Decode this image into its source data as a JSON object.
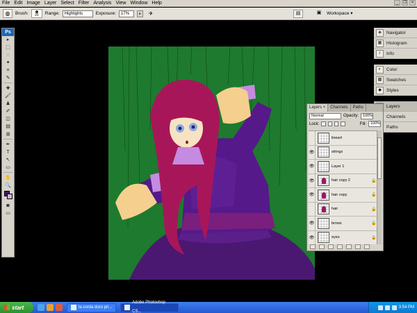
{
  "menu": {
    "items": [
      "File",
      "Edit",
      "Image",
      "Layer",
      "Select",
      "Filter",
      "Analysis",
      "View",
      "Window",
      "Help"
    ]
  },
  "options_bar": {
    "brush_label": "Brush:",
    "brush_size": "20",
    "range_label": "Range:",
    "range_value": "Highlights",
    "exposure_label": "Exposure:",
    "exposure_value": "17%",
    "workspace_label": "Workspace ▾"
  },
  "toolbox": {
    "logo": "Ps",
    "tools": [
      {
        "glyph": "▸",
        "name": "move-tool-icon"
      },
      {
        "glyph": "⬚",
        "name": "marquee-tool-icon"
      },
      {
        "glyph": "◌",
        "name": "lasso-tool-icon"
      },
      {
        "glyph": "✦",
        "name": "magic-wand-icon"
      },
      {
        "glyph": "⌗",
        "name": "crop-tool-icon"
      },
      {
        "glyph": "✎",
        "name": "slice-tool-icon"
      },
      {
        "glyph": "✚",
        "name": "healing-brush-icon"
      },
      {
        "glyph": "🖌",
        "name": "brush-tool-icon"
      },
      {
        "glyph": "♟",
        "name": "clone-stamp-icon"
      },
      {
        "glyph": "✐",
        "name": "history-brush-icon"
      },
      {
        "glyph": "◫",
        "name": "eraser-tool-icon"
      },
      {
        "glyph": "▤",
        "name": "gradient-tool-icon"
      },
      {
        "glyph": "◍",
        "name": "dodge-tool-icon"
      },
      {
        "glyph": "✒",
        "name": "pen-tool-icon"
      },
      {
        "glyph": "T",
        "name": "type-tool-icon"
      },
      {
        "glyph": "↖",
        "name": "path-selection-icon"
      },
      {
        "glyph": "▭",
        "name": "shape-tool-icon"
      },
      {
        "glyph": "✋",
        "name": "hand-tool-icon"
      },
      {
        "glyph": "🔍",
        "name": "zoom-tool-icon"
      }
    ],
    "foreground_color": "#47176a",
    "background_color": "#c9b6e3"
  },
  "dock": {
    "items": [
      {
        "label": "Navigator",
        "icon": "navigator-icon",
        "glyph": "◈"
      },
      {
        "label": "Histogram",
        "icon": "histogram-icon",
        "glyph": "▦"
      },
      {
        "label": "Info",
        "icon": "info-icon",
        "glyph": "i"
      },
      {
        "label": "Color",
        "icon": "color-icon",
        "glyph": "◐"
      },
      {
        "label": "Swatches",
        "icon": "swatches-icon",
        "glyph": "▩"
      },
      {
        "label": "Styles",
        "icon": "styles-icon",
        "glyph": "◆"
      },
      {
        "label": "Layers",
        "icon": "layers-icon",
        "glyph": "▤"
      },
      {
        "label": "Channels",
        "icon": "channels-icon",
        "glyph": "◎"
      },
      {
        "label": "Paths",
        "icon": "paths-icon",
        "glyph": "⌇"
      }
    ]
  },
  "layers_panel": {
    "tabs": [
      "Layers ×",
      "Channels",
      "Paths"
    ],
    "blend_mode": "Normal",
    "opacity_label": "Opacity:",
    "opacity_value": "100%",
    "lock_label": "Lock:",
    "fill_label": "Fill:",
    "fill_value": "100%",
    "layers": [
      {
        "name": "lineart",
        "visible": false,
        "locked": false,
        "figure": false
      },
      {
        "name": "strings",
        "visible": true,
        "locked": false,
        "figure": false
      },
      {
        "name": "Layer 1",
        "visible": true,
        "locked": false,
        "figure": false
      },
      {
        "name": "hair copy 2",
        "visible": true,
        "locked": true,
        "figure": true
      },
      {
        "name": "hair copy",
        "visible": true,
        "locked": true,
        "figure": true
      },
      {
        "name": "hair",
        "visible": false,
        "locked": true,
        "figure": true
      },
      {
        "name": "brows",
        "visible": true,
        "locked": true,
        "figure": false
      },
      {
        "name": "eyes",
        "visible": true,
        "locked": true,
        "figure": false
      }
    ]
  },
  "taskbar": {
    "start_label": "start",
    "tasks": [
      {
        "label": "la corda doro pri...",
        "active": false
      },
      {
        "label": "Adobe Photoshop CS...",
        "active": true
      }
    ],
    "clock": "3:54 PM"
  },
  "colors": {
    "canvas_background": "#1e7a2e",
    "hair": "#a8165a",
    "dress": "#4f1a7a",
    "skin": "#f4cf8d"
  }
}
